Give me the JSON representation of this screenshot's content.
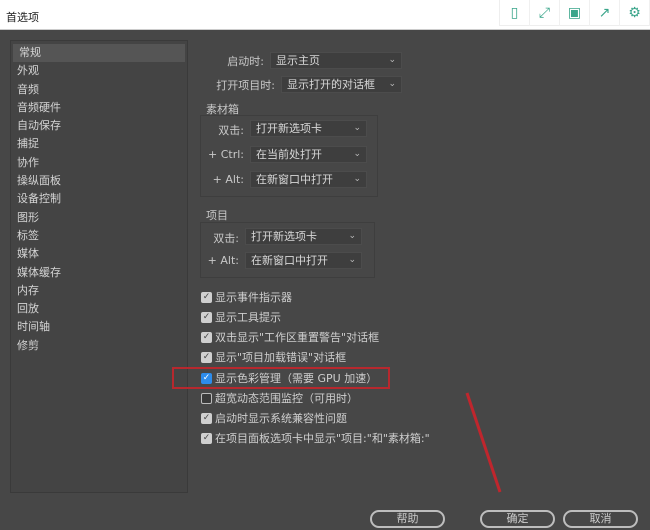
{
  "window": {
    "title": "首选项"
  },
  "toolbar_icons": [
    "phone-icon",
    "fullscreen-icon",
    "save-icon",
    "share-icon",
    "gear-icon"
  ],
  "sidebar": {
    "items": [
      "常规",
      "外观",
      "音频",
      "音频硬件",
      "自动保存",
      "捕捉",
      "协作",
      "操纵面板",
      "设备控制",
      "图形",
      "标签",
      "媒体",
      "媒体缓存",
      "内存",
      "回放",
      "时间轴",
      "修剪"
    ],
    "selected": "常规"
  },
  "general": {
    "startup": {
      "label": "启动时:",
      "value": "显示主页"
    },
    "open_project": {
      "label": "打开项目时:",
      "value": "显示打开的对话框"
    },
    "bins": {
      "title": "素材箱",
      "rows": [
        {
          "label": "双击:",
          "value": "打开新选项卡"
        },
        {
          "label": "+ Ctrl:",
          "value": "在当前处打开"
        },
        {
          "label": "+ Alt:",
          "value": "在新窗口中打开"
        }
      ]
    },
    "project": {
      "title": "项目",
      "rows": [
        {
          "label": "双击:",
          "value": "打开新选项卡"
        },
        {
          "label": "+ Alt:",
          "value": "在新窗口中打开"
        }
      ]
    },
    "checkboxes": [
      {
        "label": "显示事件指示器",
        "checked": true
      },
      {
        "label": "显示工具提示",
        "checked": true
      },
      {
        "label": "双击显示\"工作区重置警告\"对话框",
        "checked": true
      },
      {
        "label": "显示\"项目加载错误\"对话框",
        "checked": true
      },
      {
        "label": "显示色彩管理（需要 GPU 加速）",
        "checked": true
      },
      {
        "label": "超宽动态范围监控（可用时）",
        "checked": false
      },
      {
        "label": "启动时显示系统兼容性问题",
        "checked": true
      },
      {
        "label": "在项目面板选项卡中显示\"项目:\"和\"素材箱:\"",
        "checked": true
      }
    ]
  },
  "buttons": {
    "help": "帮助",
    "ok": "确定",
    "cancel": "取消"
  },
  "colors": {
    "highlight": "#b7282e",
    "accent": "#2d8ceb"
  }
}
